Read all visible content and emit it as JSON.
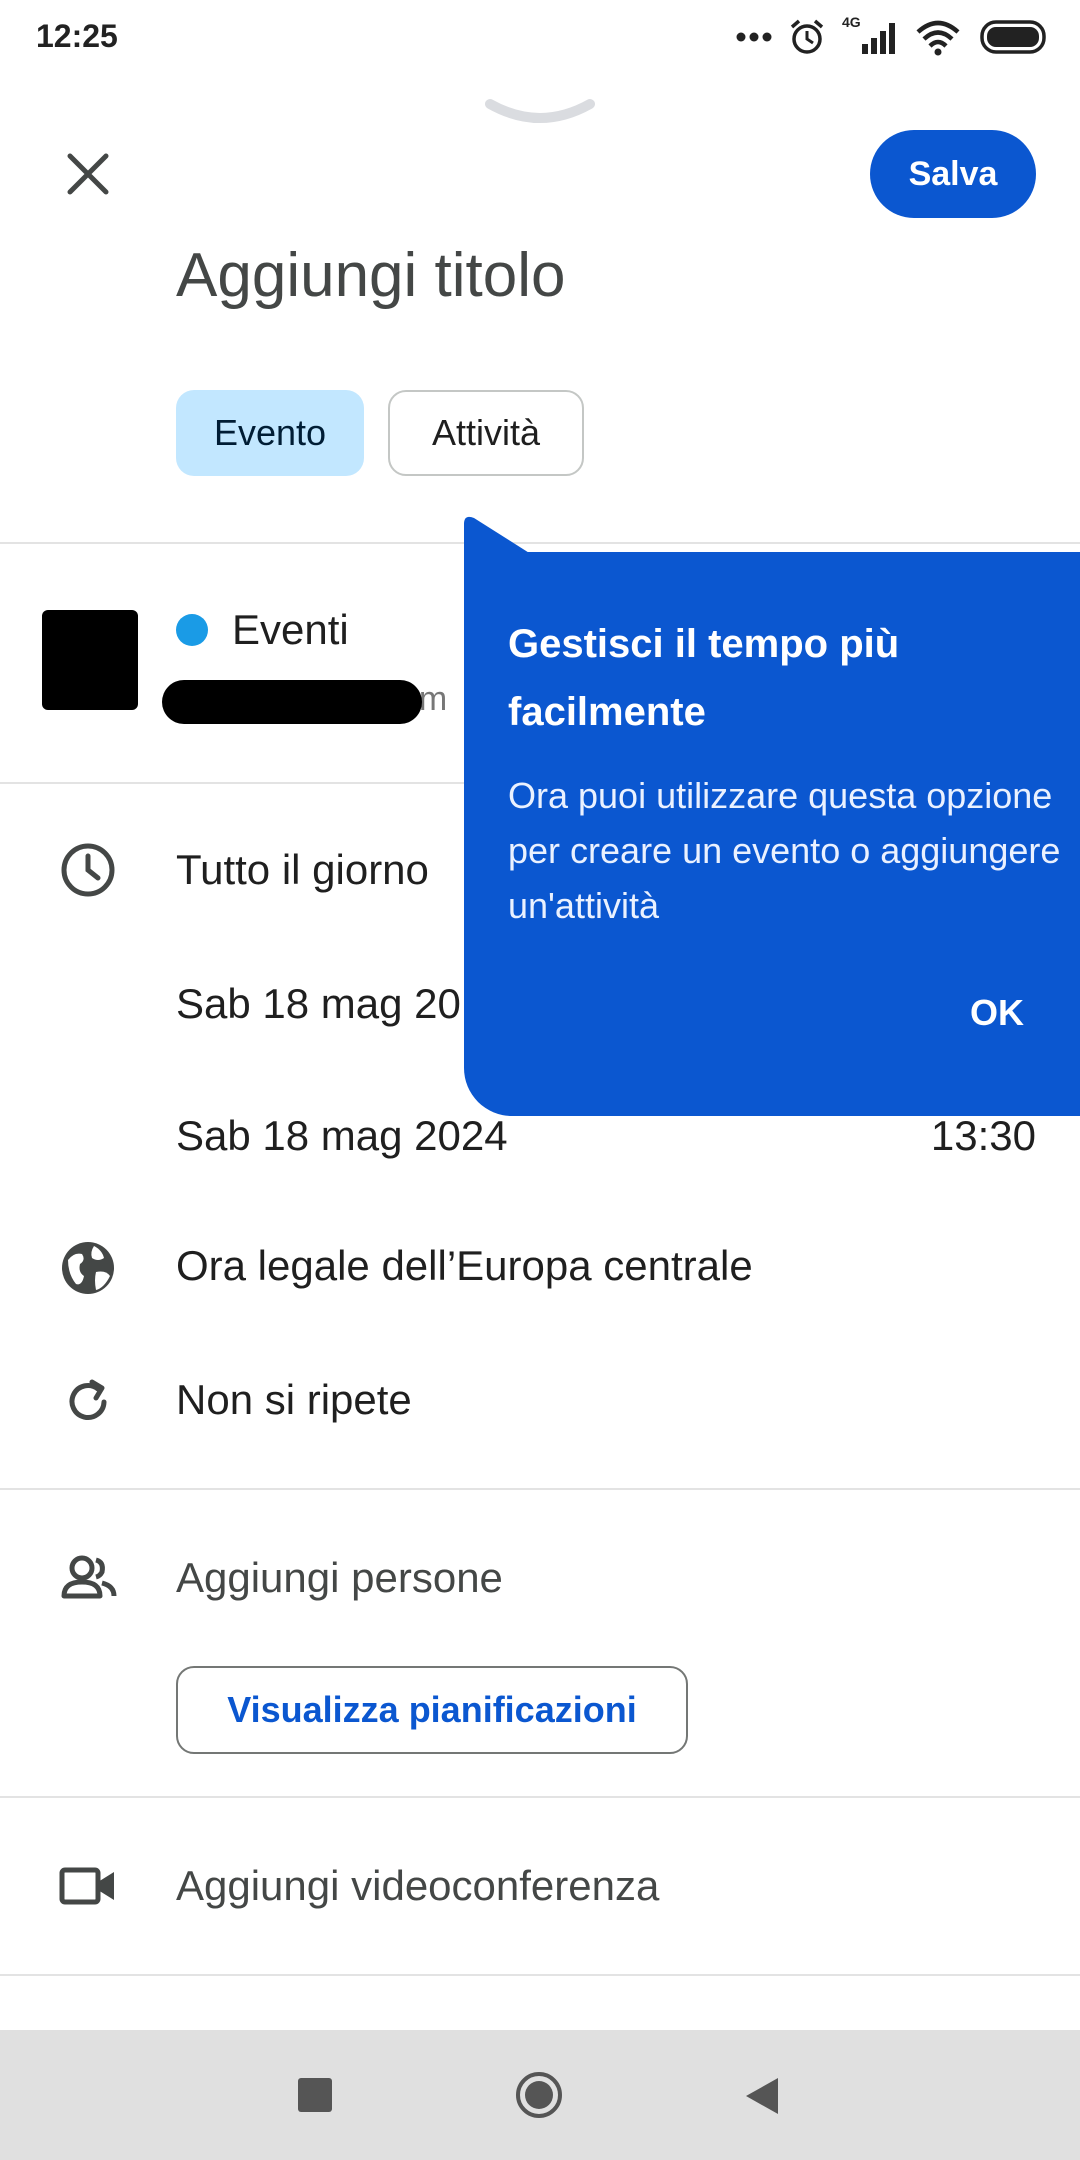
{
  "status_bar": {
    "time": "12:25",
    "network_label": "4G",
    "icons": [
      "more-dots-icon",
      "alarm-icon",
      "signal-icon",
      "wifi-icon",
      "battery-icon"
    ]
  },
  "header": {
    "close_icon": "close-icon",
    "save_label": "Salva",
    "title_placeholder": "Aggiungi titolo"
  },
  "type_chips": [
    {
      "label": "Evento",
      "selected": true
    },
    {
      "label": "Attività",
      "selected": false
    }
  ],
  "calendar": {
    "name": "Eventi",
    "color": "#1a9be6",
    "email_visible_fragment": "gm"
  },
  "datetime": {
    "all_day_label": "Tutto il giorno",
    "start_date": "Sab 18 mag 20",
    "end_date": "Sab 18 mag 2024",
    "end_time": "13:30",
    "timezone": "Ora legale dell’Europa centrale",
    "repeat": "Non si ripete"
  },
  "people": {
    "add_label": "Aggiungi persone",
    "schedules_button": "Visualizza pianificazioni"
  },
  "conference": {
    "add_label": "Aggiungi videoconferenza"
  },
  "tooltip": {
    "title": "Gestisci il tempo più facilmente",
    "body": "Ora puoi utilizzare questa opzione per creare un evento o aggiungere un'attività",
    "ok_label": "OK",
    "background": "#0b57d0"
  },
  "colors": {
    "accent": "#0b57d0",
    "chip_selected_bg": "#c2e7ff"
  }
}
